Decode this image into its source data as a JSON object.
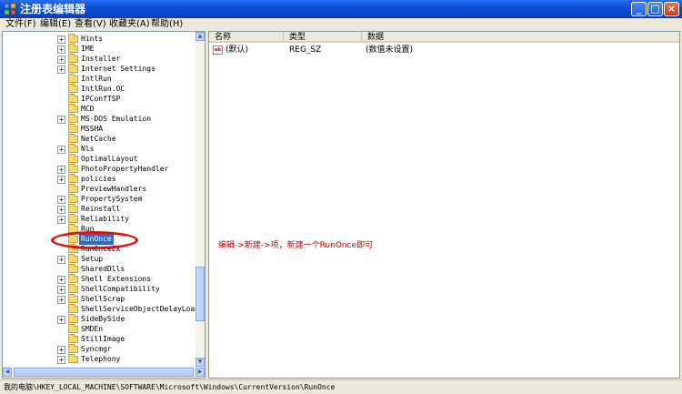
{
  "window": {
    "title": "注册表编辑器",
    "minimize_glyph": "_",
    "maximize_glyph": "□",
    "close_glyph": "×"
  },
  "menu": [
    {
      "label": "文件(F)"
    },
    {
      "label": "编辑(E)"
    },
    {
      "label": "查看(V)"
    },
    {
      "label": "收藏夹(A)"
    },
    {
      "label": "帮助(H)"
    }
  ],
  "tree": {
    "items": [
      {
        "label": "Hints",
        "expandable": true
      },
      {
        "label": "IME",
        "expandable": true
      },
      {
        "label": "Installer",
        "expandable": true
      },
      {
        "label": "Internet Settings",
        "expandable": true
      },
      {
        "label": "IntlRun",
        "expandable": false
      },
      {
        "label": "IntlRun.OC",
        "expandable": false
      },
      {
        "label": "IPConfTSP",
        "expandable": false
      },
      {
        "label": "MCD",
        "expandable": false
      },
      {
        "label": "MS-DOS Emulation",
        "expandable": true
      },
      {
        "label": "MSSHA",
        "expandable": false
      },
      {
        "label": "NetCache",
        "expandable": false
      },
      {
        "label": "Nls",
        "expandable": true
      },
      {
        "label": "OptimalLayout",
        "expandable": false
      },
      {
        "label": "PhotoPropertyHandler",
        "expandable": true
      },
      {
        "label": "policies",
        "expandable": true
      },
      {
        "label": "PreviewHandlers",
        "expandable": false
      },
      {
        "label": "PropertySystem",
        "expandable": true
      },
      {
        "label": "Reinstall",
        "expandable": true
      },
      {
        "label": "Reliability",
        "expandable": true
      },
      {
        "label": "Run",
        "expandable": false
      },
      {
        "label": "RunOnce",
        "expandable": false,
        "selected": true
      },
      {
        "label": "RunOnceEx",
        "expandable": false
      },
      {
        "label": "Setup",
        "expandable": true
      },
      {
        "label": "SharedDlls",
        "expandable": false
      },
      {
        "label": "Shell Extensions",
        "expandable": true
      },
      {
        "label": "ShellCompatibility",
        "expandable": true
      },
      {
        "label": "ShellScrap",
        "expandable": true
      },
      {
        "label": "ShellServiceObjectDelayLoad",
        "expandable": false
      },
      {
        "label": "SideBySide",
        "expandable": true
      },
      {
        "label": "SMDEn",
        "expandable": false
      },
      {
        "label": "StillImage",
        "expandable": false
      },
      {
        "label": "Syncmgr",
        "expandable": true
      },
      {
        "label": "Telephony",
        "expandable": true
      }
    ],
    "expander_glyph": "+"
  },
  "list": {
    "columns": [
      {
        "label": "名称"
      },
      {
        "label": "类型"
      },
      {
        "label": "数据"
      }
    ],
    "rows": [
      {
        "icon": "reg-string-icon",
        "icon_text": "ab",
        "name": "(默认)",
        "type": "REG_SZ",
        "data": "(数值未设置)"
      }
    ]
  },
  "annotation": {
    "text": "编辑->新建->项，新建一个RunOnce即可",
    "color": "#c00000"
  },
  "status": {
    "path": "我的电脑\\HKEY_LOCAL_MACHINE\\SOFTWARE\\Microsoft\\Windows\\CurrentVersion\\RunOnce"
  },
  "colors": {
    "title_bar": "#0b4ed8",
    "selection": "#316ac5",
    "folder": "#f6d86b",
    "annotation_red": "#e01010"
  }
}
